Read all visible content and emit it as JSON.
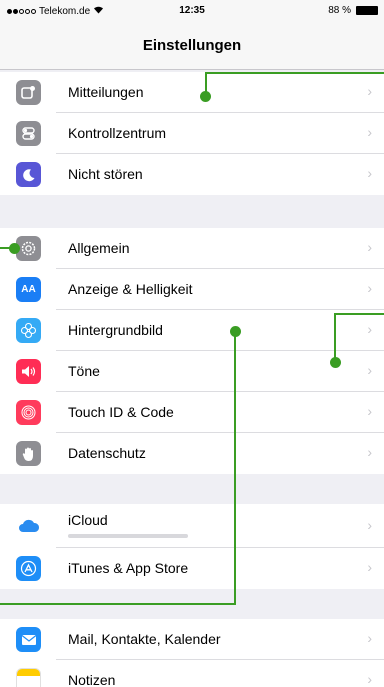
{
  "status_bar": {
    "carrier": "Telekom.de",
    "time": "12:35",
    "battery": "88 %"
  },
  "nav": {
    "title": "Einstellungen"
  },
  "rows": {
    "mitteilungen": "Mitteilungen",
    "kontrollzentrum": "Kontrollzentrum",
    "nicht_stoeren": "Nicht stören",
    "allgemein": "Allgemein",
    "anzeige": "Anzeige & Helligkeit",
    "hintergrundbild": "Hintergrundbild",
    "toene": "Töne",
    "touch_id": "Touch ID & Code",
    "datenschutz": "Datenschutz",
    "icloud": "iCloud",
    "itunes": "iTunes & App Store",
    "mail": "Mail, Kontakte, Kalender",
    "notizen": "Notizen"
  },
  "icon_glyphs": {
    "anzeige": "AA"
  },
  "colors": {
    "callout": "#3a9d23",
    "chevron": "#c7c7cc"
  }
}
